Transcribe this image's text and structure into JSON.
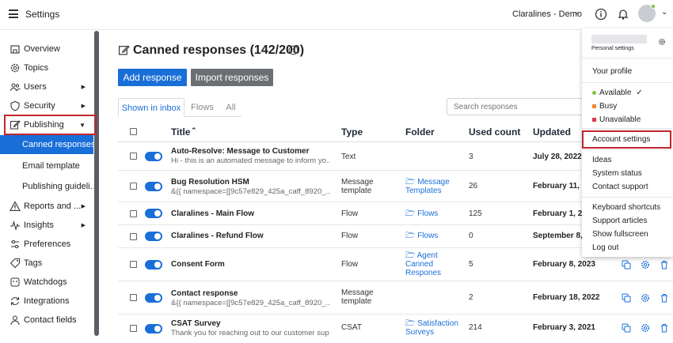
{
  "header": {
    "app_title": "Settings",
    "workspace": "Claralines - Demo"
  },
  "sidebar": {
    "items": [
      {
        "label": "Overview",
        "icon": "building-icon"
      },
      {
        "label": "Topics",
        "icon": "gear-icon"
      },
      {
        "label": "Users",
        "icon": "users-icon"
      },
      {
        "label": "Security",
        "icon": "shield-icon"
      },
      {
        "label": "Publishing",
        "icon": "edit-icon"
      },
      {
        "label": "Reports and ...",
        "icon": "warning-icon"
      },
      {
        "label": "Insights",
        "icon": "pulse-icon"
      },
      {
        "label": "Preferences",
        "icon": "sliders-icon"
      },
      {
        "label": "Tags",
        "icon": "tag-icon"
      },
      {
        "label": "Watchdogs",
        "icon": "watchdog-icon"
      },
      {
        "label": "Integrations",
        "icon": "sync-icon"
      },
      {
        "label": "Contact fields",
        "icon": "person-icon"
      }
    ],
    "sub_items": [
      "Canned responses",
      "Email template",
      "Publishing guideli..."
    ]
  },
  "main": {
    "title": "Canned responses (142/200)",
    "add_button": "Add response",
    "import_button": "Import responses",
    "tabs": [
      "Shown in inbox",
      "Flows",
      "All"
    ],
    "search_placeholder": "Search responses",
    "columns": [
      "Title",
      "Type",
      "Folder",
      "Used count",
      "Updated"
    ],
    "rows": [
      {
        "title": "Auto-Resolve: Message to Customer",
        "desc": "Hi - this is an automated message to inform yo...",
        "type": "Text",
        "folder": "",
        "used": "3",
        "updated": "July 28, 2022"
      },
      {
        "title": "Bug Resolution HSM",
        "desc": "&{{ namespace=[[9c57e829_425a_caff_8920_...",
        "type": "Message template",
        "folder": "Message Templates",
        "used": "26",
        "updated": "February 11, 2"
      },
      {
        "title": "Claralines - Main Flow",
        "desc": "",
        "type": "Flow",
        "folder": "Flows",
        "used": "125",
        "updated": "February 1, 20"
      },
      {
        "title": "Claralines - Refund Flow",
        "desc": "",
        "type": "Flow",
        "folder": "Flows",
        "used": "0",
        "updated": "September 8, 2"
      },
      {
        "title": "Consent Form",
        "desc": "",
        "type": "Flow",
        "folder": "Agent Canned Respones",
        "used": "5",
        "updated": "February 8, 2023"
      },
      {
        "title": "Contact response",
        "desc": "&{{ namespace=[[9c57e829_425a_caff_8920_...",
        "type": "Message template",
        "folder": "",
        "used": "2",
        "updated": "February 18, 2022"
      },
      {
        "title": "CSAT Survey",
        "desc": "Thank you for reaching out to our customer sup...",
        "type": "CSAT",
        "folder": "Satisfaction Surveys",
        "used": "214",
        "updated": "February 3, 2021"
      }
    ]
  },
  "dropdown": {
    "personal_settings": "Personal settings",
    "your_profile": "Your profile",
    "available": "Available",
    "busy": "Busy",
    "unavailable": "Unavailable",
    "account_settings": "Account settings",
    "ideas": "Ideas",
    "system_status": "System status",
    "contact_support": "Contact support",
    "keyboard_shortcuts": "Keyboard shortcuts",
    "support_articles": "Support articles",
    "show_fullscreen": "Show fullscreen",
    "log_out": "Log out"
  },
  "colors": {
    "accent": "#1a6ed8",
    "highlight_box": "#c1272d",
    "available": "#7ec242",
    "busy": "#f0862f",
    "unavailable": "#e0344b"
  }
}
